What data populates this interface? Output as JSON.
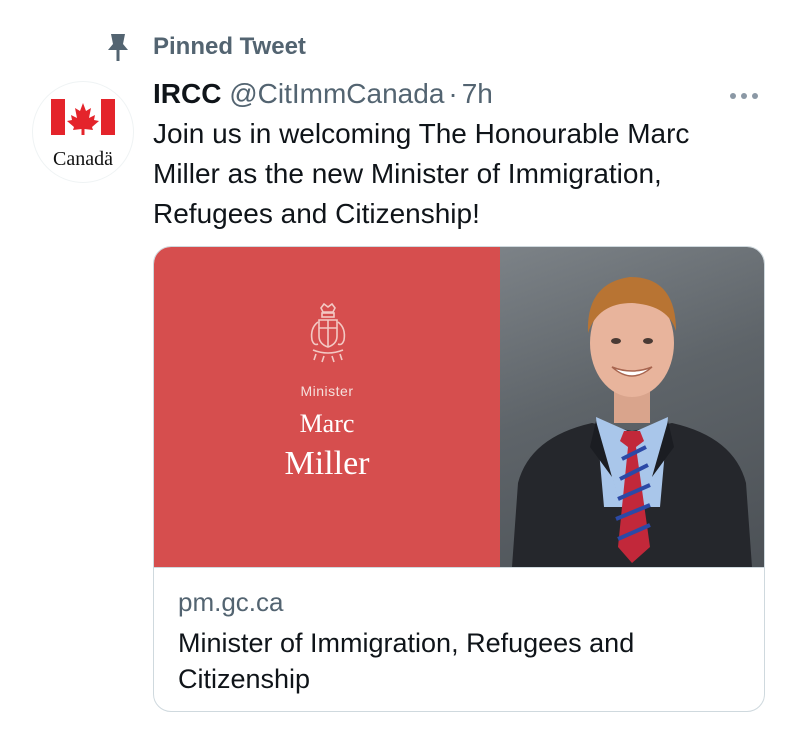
{
  "pinned": {
    "label": "Pinned Tweet",
    "icon": "pin-icon"
  },
  "author": {
    "name": "IRCC",
    "handle": "@CitImmCanada",
    "separator": "·",
    "time": "7h",
    "avatar_text": "Canadä",
    "avatar_icon": "canada-flag-icon"
  },
  "tweet": {
    "text": "Join us in welcoming The Honourable Marc Miller as the new Minister of Immigration, Refugees and Citizenship!"
  },
  "card": {
    "role": "Minister",
    "first_name": "Marc",
    "last_name": "Miller",
    "domain": "pm.gc.ca",
    "title": "Minister of Immigration, Refugees and Citizenship"
  },
  "colors": {
    "card_red": "#d64e4e",
    "flag_red": "#e4242b",
    "secondary_text": "#536471",
    "border": "#cfd9de"
  }
}
